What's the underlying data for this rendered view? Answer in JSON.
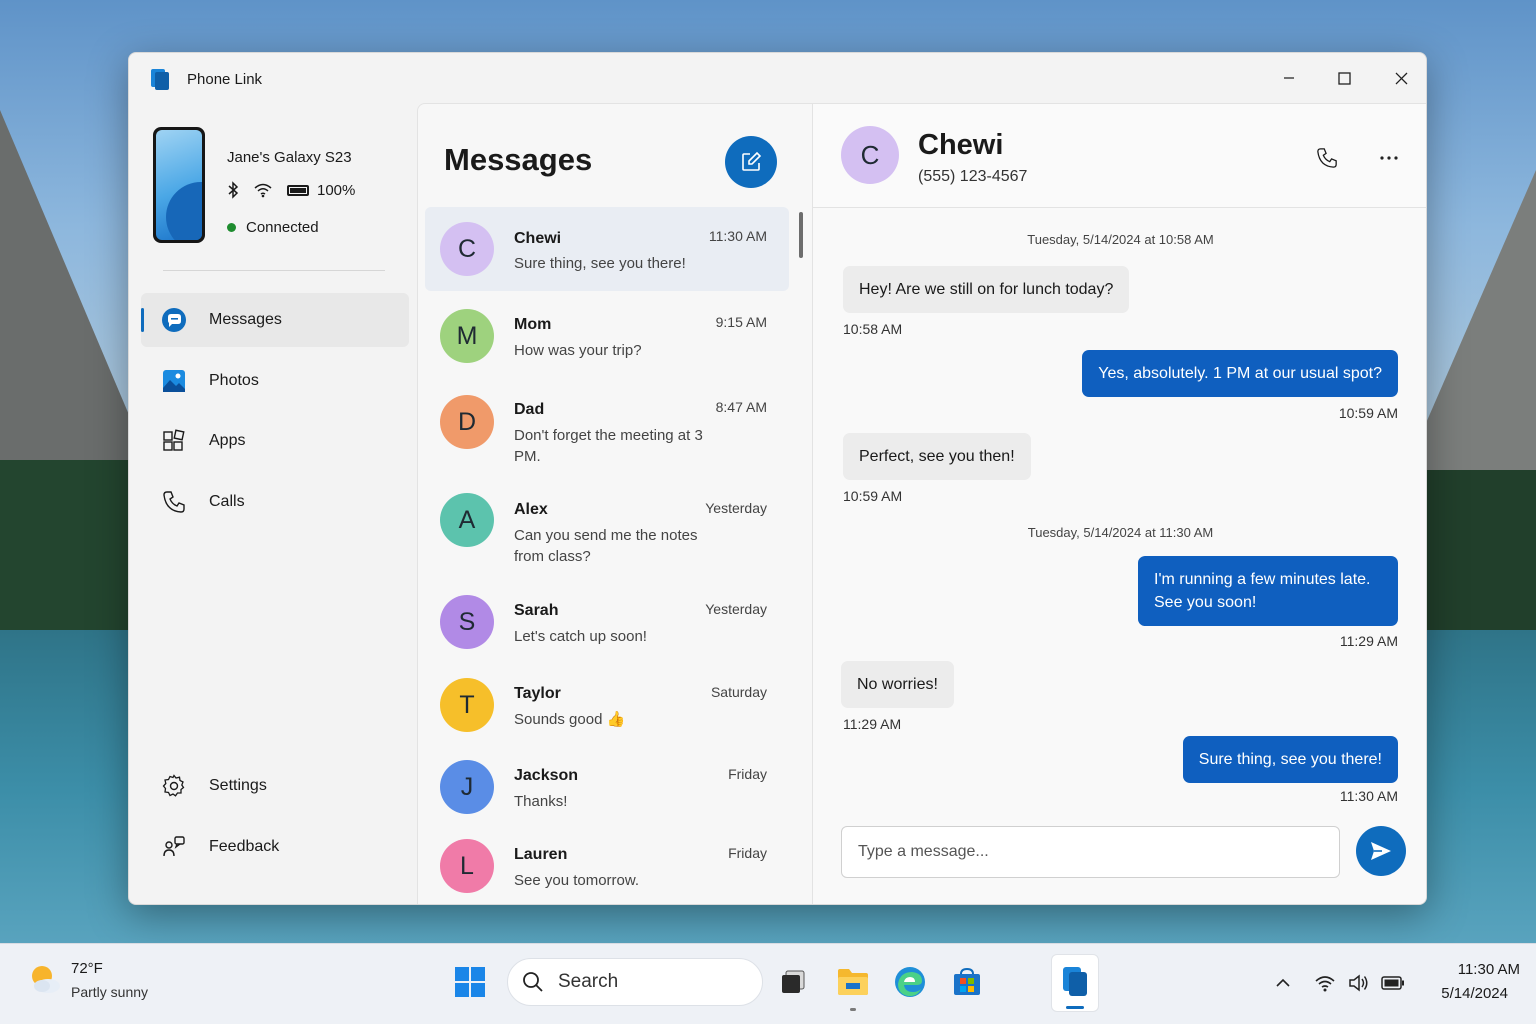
{
  "app": {
    "title": "Phone Link"
  },
  "device": {
    "name": "Jane's Galaxy S23",
    "battery": "100%",
    "status": "Connected"
  },
  "nav": {
    "items": [
      {
        "label": "Messages"
      },
      {
        "label": "Photos"
      },
      {
        "label": "Apps"
      },
      {
        "label": "Calls"
      }
    ],
    "bottom": [
      {
        "label": "Settings"
      },
      {
        "label": "Feedback"
      }
    ]
  },
  "messages_list": {
    "title": "Messages",
    "conversations": [
      {
        "initial": "C",
        "name": "Chewi",
        "preview": "Sure thing, see you there!",
        "time": "11:30 AM",
        "color": "#d4c0f2"
      },
      {
        "initial": "M",
        "name": "Mom",
        "preview": "How was your trip?",
        "time": "9:15 AM",
        "color": "#9ed27e"
      },
      {
        "initial": "D",
        "name": "Dad",
        "preview": "Don't forget the meeting at 3 PM.",
        "time": "8:47 AM",
        "color": "#f09a6a"
      },
      {
        "initial": "A",
        "name": "Alex",
        "preview": "Can you send me the notes from class?",
        "time": "Yesterday",
        "color": "#5cc3ad"
      },
      {
        "initial": "S",
        "name": "Sarah",
        "preview": "Let's catch up soon!",
        "time": "Yesterday",
        "color": "#b18ae6"
      },
      {
        "initial": "T",
        "name": "Taylor",
        "preview": "Sounds good 👍",
        "time": "Saturday",
        "color": "#f6bf2a"
      },
      {
        "initial": "J",
        "name": "Jackson",
        "preview": "Thanks!",
        "time": "Friday",
        "color": "#5a8de6"
      },
      {
        "initial": "L",
        "name": "Lauren",
        "preview": "See you tomorrow.",
        "time": "Friday",
        "color": "#f07ba8"
      }
    ]
  },
  "chat": {
    "contact_initial": "C",
    "contact_name": "Chewi",
    "contact_phone": "(555) 123-4567",
    "date_sep_1": "Tuesday, 5/14/2024 at 10:58 AM",
    "date_sep_2": "Tuesday, 5/14/2024 at 11:30 AM",
    "messages": [
      {
        "dir": "in",
        "text": "Hey! Are we still on for lunch today?",
        "time": "10:58 AM"
      },
      {
        "dir": "out",
        "text": "Yes, absolutely. 1 PM at our usual spot?",
        "time": "10:59 AM"
      },
      {
        "dir": "in",
        "text": "Perfect, see you then!",
        "time": "10:59 AM"
      },
      {
        "dir": "out",
        "text": "I'm running a few minutes late. See you soon!",
        "time": "11:29 AM"
      },
      {
        "dir": "in",
        "text": "No worries!",
        "time": "11:29 AM"
      },
      {
        "dir": "out",
        "text": "Sure thing, see you there!",
        "time": "11:30 AM"
      }
    ],
    "compose_placeholder": "Type a message..."
  },
  "taskbar": {
    "weather_temp": "72°F",
    "weather_desc": "Partly sunny",
    "search_label": "Search",
    "clock_time": "11:30 AM",
    "clock_date": "5/14/2024"
  },
  "colors": {
    "accent": "#0f6cbd",
    "outgoing_bubble": "#0f5fbf",
    "incoming_bubble": "#ececec",
    "connected": "#1e8c2f"
  },
  "icons": [
    "phone-link-icon",
    "bluetooth-icon",
    "wifi-icon",
    "battery-icon",
    "messages-icon",
    "photos-icon",
    "apps-icon",
    "calls-icon",
    "settings-icon",
    "feedback-icon",
    "compose-icon",
    "phone-call-icon",
    "more-icon",
    "send-icon",
    "weather-icon",
    "windows-start-icon",
    "search-icon",
    "task-view-icon",
    "file-explorer-icon",
    "edge-icon",
    "store-icon",
    "chevron-up-icon",
    "volume-icon"
  ]
}
